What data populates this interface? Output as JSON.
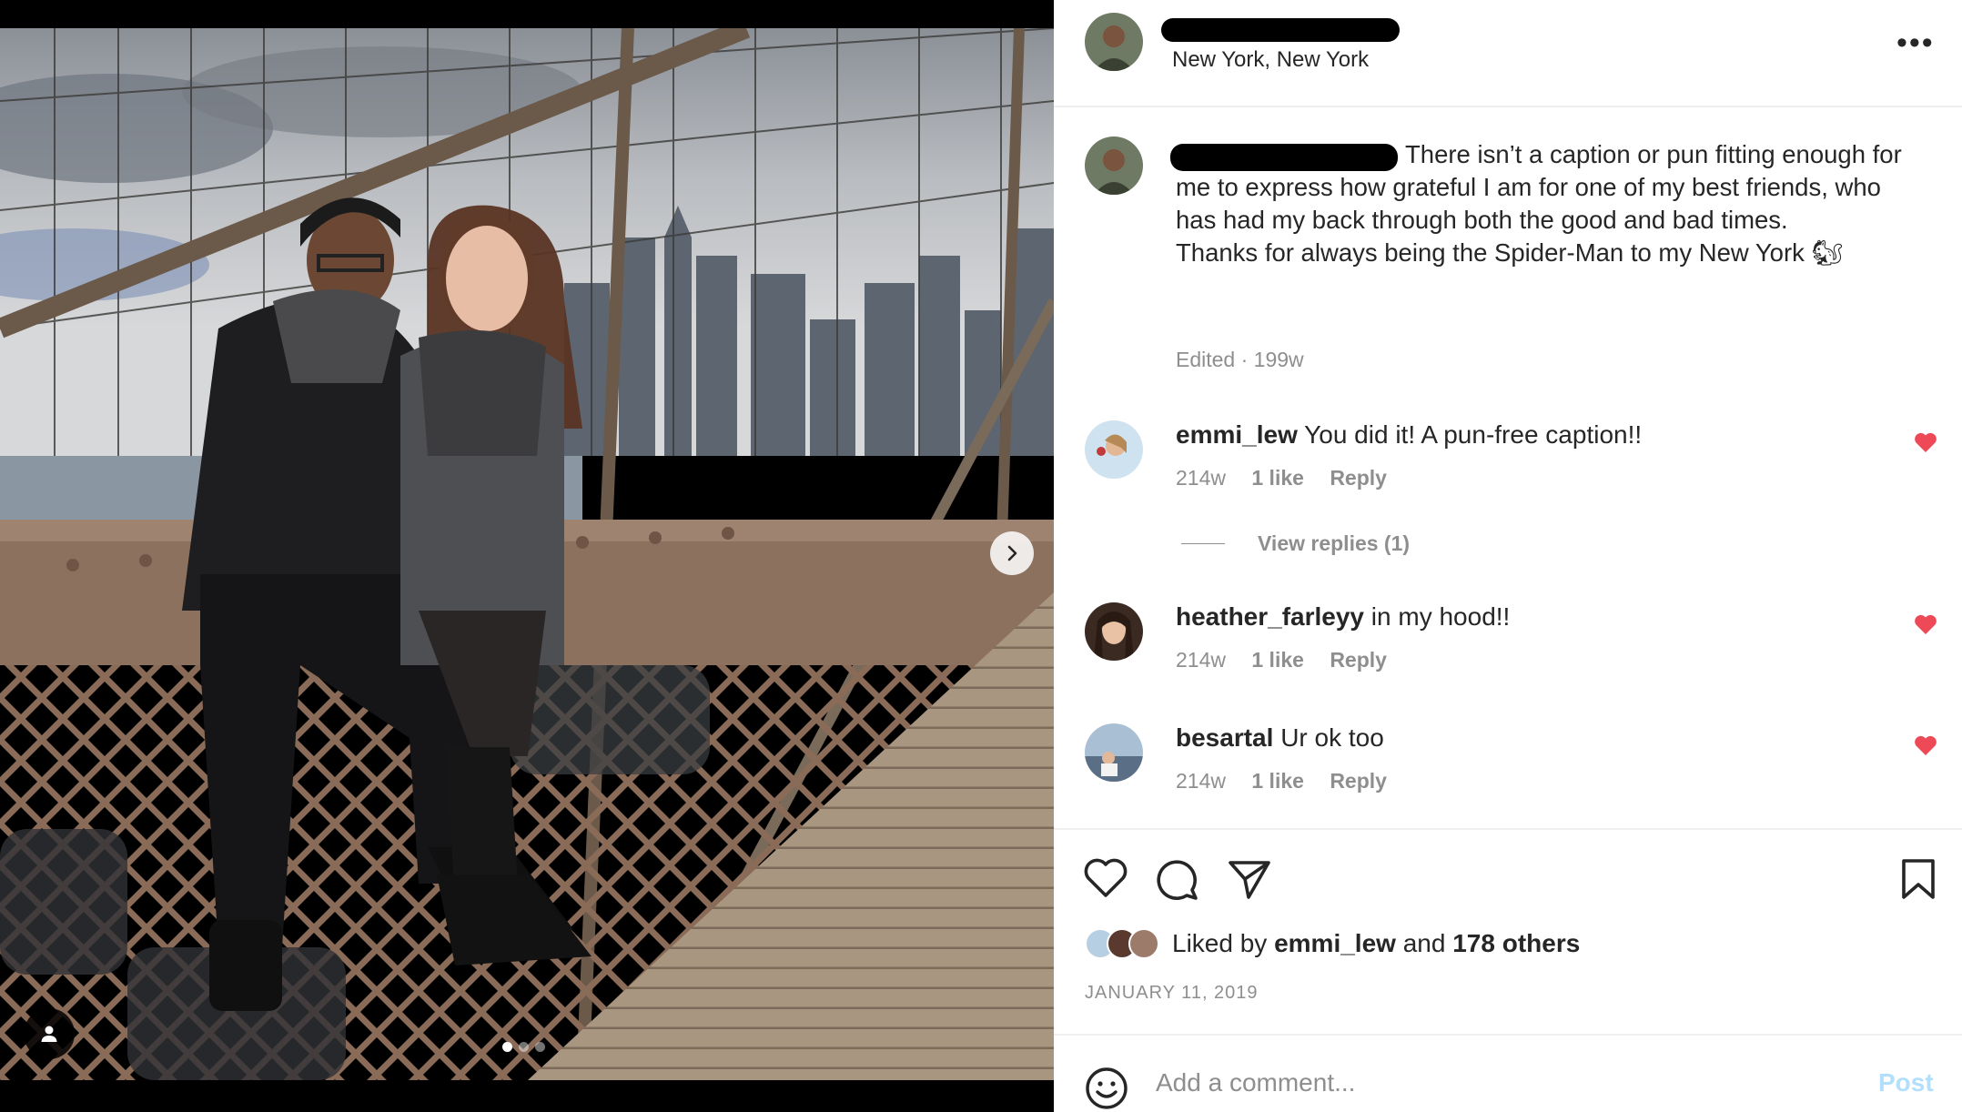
{
  "post": {
    "location": "New York, New York",
    "more_label": "•••",
    "image_count": 3,
    "active_image_index": 0
  },
  "caption": {
    "text": "There isn’t a caption or pun fitting enough for me to express how grateful I am for one of my best friends, who has had my back through both the good and bad times.",
    "text2": "Thanks for always being the Spider-Man to my New York 🐿",
    "edited_label": "Edited",
    "separator": "·",
    "age": "199w"
  },
  "comments": [
    {
      "user": "emmi_lew",
      "text": "You did it! A pun-free caption!!",
      "age": "214w",
      "likes": "1 like",
      "reply": "Reply",
      "liked": true
    },
    {
      "user": "heather_farleyy",
      "text": "in my hood!!",
      "age": "214w",
      "likes": "1 like",
      "reply": "Reply",
      "liked": true
    },
    {
      "user": "besartal",
      "text": "Ur ok too",
      "age": "214w",
      "likes": "1 like",
      "reply": "Reply",
      "liked": true
    }
  ],
  "view_replies": "View replies (1)",
  "likes": {
    "prefix": "Liked by",
    "user": "emmi_lew",
    "and": "and",
    "others": "178 others"
  },
  "date": "JANUARY 11, 2019",
  "add_comment": {
    "placeholder": "Add a comment...",
    "post_label": "Post"
  },
  "icons": {
    "heart": "heart-icon",
    "comment": "comment-icon",
    "share": "share-icon",
    "save": "bookmark-icon",
    "emoji": "emoji-icon",
    "next": "chevron-right-icon",
    "tag": "user-tag-icon"
  },
  "colors": {
    "like_red": "#ed4956",
    "post_disabled": "#b2dffc",
    "meta_gray": "#8e8e8e"
  }
}
